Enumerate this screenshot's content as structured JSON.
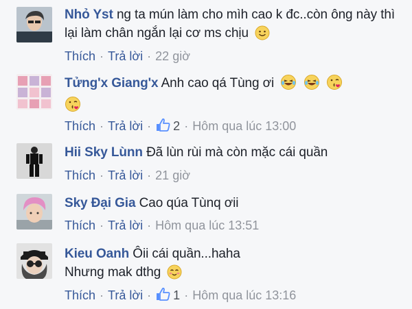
{
  "comments": [
    {
      "author": "Nhỏ Yst",
      "text": "ng ta mún làm cho mìh cao k đc..còn ông này thì lại làm chân ngắn lại cơ ms chịu",
      "emojis": [
        "smile-emoji"
      ],
      "like_label": "Thích",
      "reply_label": "Trả lời",
      "like_count": "",
      "time": "22 giờ"
    },
    {
      "author": "Tửng'x Giang'x",
      "text": "Anh cao qá Tùng ơi",
      "emojis": [
        "laughing-tears-emoji",
        "laughing-tears-emoji",
        "kiss-emoji",
        "kiss-emoji"
      ],
      "like_label": "Thích",
      "reply_label": "Trả lời",
      "like_count": "2",
      "time": "Hôm qua lúc 13:00"
    },
    {
      "author": "Hii Sky Lùnn",
      "text": "Đã lùn rùi mà còn mặc cái quần",
      "emojis": [],
      "like_label": "Thích",
      "reply_label": "Trả lời",
      "like_count": "",
      "time": "21 giờ"
    },
    {
      "author": "Sky Đại Gia",
      "text": "Cao qúa Tùnq ơii",
      "emojis": [],
      "like_label": "Thích",
      "reply_label": "Trả lời",
      "like_count": "",
      "time": "Hôm qua lúc 13:51"
    },
    {
      "author": "Kieu Oanh",
      "text": "Ôii cái quần...haha",
      "text_line2": "Nhưng mak dthg",
      "emojis": [
        "blush-emoji"
      ],
      "like_label": "Thích",
      "reply_label": "Trả lời",
      "like_count": "1",
      "time": "Hôm qua lúc 13:16"
    }
  ],
  "colors": {
    "author": "#365899",
    "link": "#365899",
    "meta": "#90949c",
    "text": "#1d2129",
    "background": "#f6f7f9"
  }
}
